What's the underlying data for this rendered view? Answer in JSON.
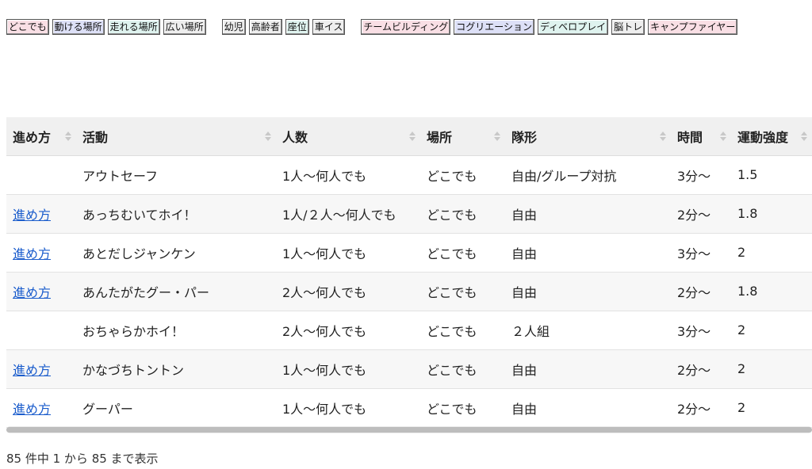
{
  "filters": {
    "location": [
      {
        "label": "どこでも",
        "color": "#f9dfe5"
      },
      {
        "label": "動ける場所",
        "color": "#dde0f7"
      },
      {
        "label": "走れる場所",
        "color": "#dff3ef"
      },
      {
        "label": "広い場所",
        "color": "#eeeeee"
      }
    ],
    "participants": [
      {
        "label": "幼児",
        "color": "#eeeeee"
      },
      {
        "label": "高齢者",
        "color": "#eeeeee"
      },
      {
        "label": "座位",
        "color": "#dff3ef"
      },
      {
        "label": "車イス",
        "color": "#eeeeee"
      }
    ],
    "purpose": [
      {
        "label": "チームビルディング",
        "color": "#f9dfe5"
      },
      {
        "label": "コグリエーション",
        "color": "#dde0f7"
      },
      {
        "label": "ディベロプレイ",
        "color": "#dff3ef"
      },
      {
        "label": "脳トレ",
        "color": "#eeeeee"
      },
      {
        "label": "キャンプファイヤー",
        "color": "#f9dfe5"
      }
    ]
  },
  "table": {
    "headers": [
      "進め方",
      "活動",
      "人数",
      "場所",
      "隊形",
      "時間",
      "運動強度"
    ],
    "rows": [
      {
        "howto": "",
        "activity": "アウトセーフ",
        "people": "1人〜何人でも",
        "place": "どこでも",
        "formation": "自由/グループ対抗",
        "time": "3分〜",
        "intensity": "1.5"
      },
      {
        "howto": "進め方",
        "activity": "あっちむいてホイ！",
        "people": "1人/２人〜何人でも",
        "place": "どこでも",
        "formation": "自由",
        "time": "2分〜",
        "intensity": "1.8"
      },
      {
        "howto": "進め方",
        "activity": "あとだしジャンケン",
        "people": "1人〜何人でも",
        "place": "どこでも",
        "formation": "自由",
        "time": "3分〜",
        "intensity": "2"
      },
      {
        "howto": "進め方",
        "activity": "あんたがたグー・パー",
        "people": "2人〜何人でも",
        "place": "どこでも",
        "formation": "自由",
        "time": "2分〜",
        "intensity": "1.8"
      },
      {
        "howto": "",
        "activity": "おちゃらかホイ！",
        "people": "2人〜何人でも",
        "place": "どこでも",
        "formation": "２人組",
        "time": "3分〜",
        "intensity": "2"
      },
      {
        "howto": "進め方",
        "activity": "かなづちトントン",
        "people": "1人〜何人でも",
        "place": "どこでも",
        "formation": "自由",
        "time": "2分〜",
        "intensity": "2"
      },
      {
        "howto": "進め方",
        "activity": "グーパー",
        "people": "1人〜何人でも",
        "place": "どこでも",
        "formation": "自由",
        "time": "2分〜",
        "intensity": "2"
      }
    ]
  },
  "info": "85 件中 1 から 85 まで表示"
}
